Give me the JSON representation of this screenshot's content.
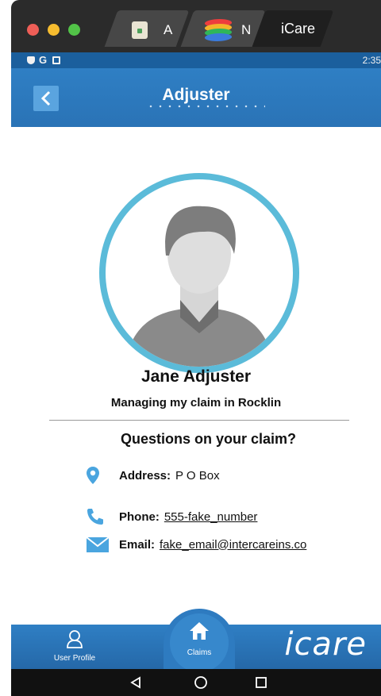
{
  "window": {
    "tabs": [
      {
        "label": "A",
        "icon": "document-icon"
      },
      {
        "label": "N",
        "icon": "bluestacks-icon"
      },
      {
        "label": "iCare",
        "active": true
      }
    ]
  },
  "status_bar": {
    "time": "2:35",
    "icons": [
      "shield-icon",
      "google-g-icon",
      "a-box-icon"
    ]
  },
  "header": {
    "title": "Adjuster",
    "back_icon": "chevron-left-icon"
  },
  "profile": {
    "name": "Jane Adjuster",
    "subtitle": "Managing my claim in Rocklin"
  },
  "contact": {
    "heading": "Questions on your claim?",
    "address_label": "Address:",
    "address_value": "P O Box",
    "phone_label": "Phone:",
    "phone_value": "555-fake_number",
    "email_label": "Email:",
    "email_value": "fake_email@intercareins.co"
  },
  "tabbar": {
    "user_profile": "User Profile",
    "claims": "Claims",
    "brand": "icare"
  },
  "colors": {
    "primary": "#2f7fc4",
    "avatar_ring": "#5bbbd9",
    "icon_blue": "#4aa5df"
  }
}
